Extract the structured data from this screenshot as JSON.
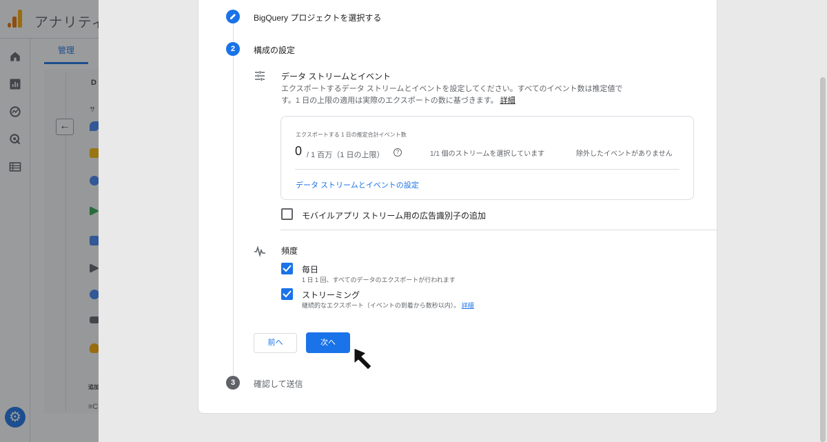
{
  "background": {
    "app_title": "アナリティ",
    "tab_admin": "管理",
    "col_header_partial": "D",
    "section_partial": "サ",
    "add_partial": "追加",
    "bottom_partial": "≡C",
    "back_arrow": "←"
  },
  "steps": [
    {
      "number": "",
      "label": "BigQuery プロジェクトを選択する",
      "state": "done"
    },
    {
      "number": "2",
      "label": "構成の設定",
      "state": "active"
    },
    {
      "number": "3",
      "label": "確認して送信",
      "state": "pending"
    }
  ],
  "data_streams": {
    "title": "データ ストリームとイベント",
    "description_line1": "エクスポートするデータ ストリームとイベントを設定してください。すべてのイベント数は推定値で",
    "description_line2": "す。1 日の上限の適用は実際のエクスポートの数に基づきます。",
    "details_link": "詳細",
    "estimate_caption": "エクスポートする 1 日の推定合計イベント数",
    "estimate_value": "0",
    "estimate_limit": "/ 1 百万（1 日の上限）",
    "help_glyph": "?",
    "streams_selected": "1/1 個のストリームを選択しています",
    "excluded_events": "除外したイベントがありません",
    "configure_link": "データ ストリームとイベントの設定"
  },
  "ad_id_checkbox": {
    "label": "モバイルアプリ ストリーム用の広告識別子の追加",
    "checked": false
  },
  "frequency": {
    "title": "頻度",
    "daily_label": "毎日",
    "daily_desc": "1 日 1 回、すべてのデータのエクスポートが行われます",
    "streaming_label": "ストリーミング",
    "streaming_desc": "継続的なエクスポート（イベントの到着から数秒以内）。",
    "streaming_link": "詳細"
  },
  "buttons": {
    "prev": "前へ",
    "next": "次へ"
  },
  "colors": {
    "accent": "#1a73e8",
    "analytics_orange": "#e37400",
    "analytics_yellow": "#f9ab00"
  }
}
